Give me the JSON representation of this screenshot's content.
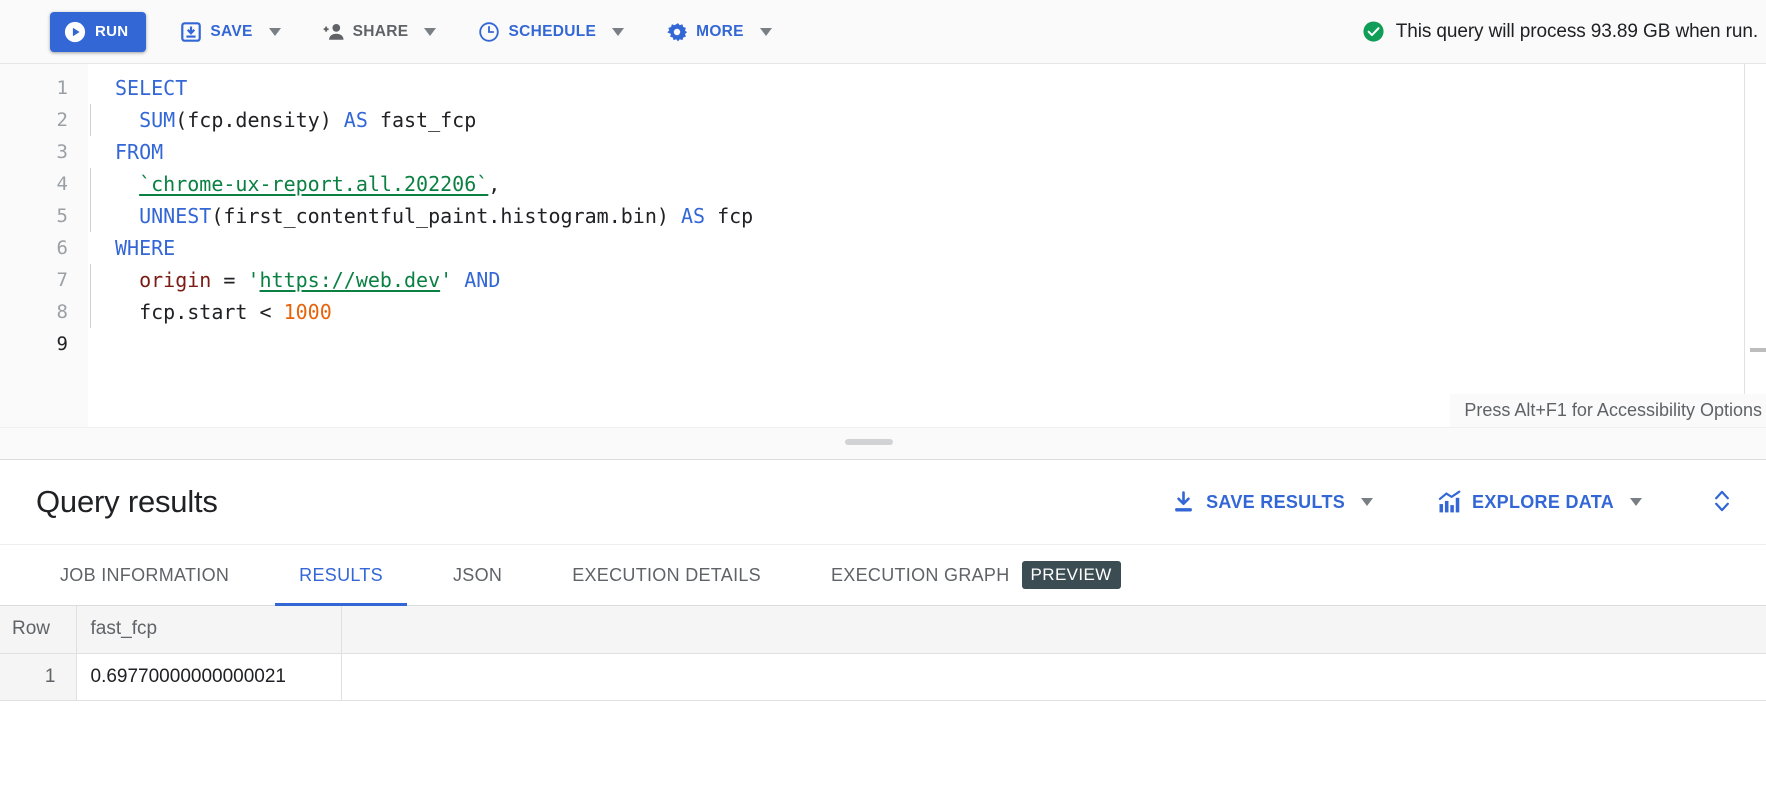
{
  "toolbar": {
    "run_label": "RUN",
    "save_label": "SAVE",
    "share_label": "SHARE",
    "schedule_label": "SCHEDULE",
    "more_label": "MORE",
    "status_text": "This query will process 93.89 GB when run.",
    "accent_color": "#3367d6",
    "status_color": "#0b8043"
  },
  "editor": {
    "line_numbers": [
      "1",
      "2",
      "3",
      "4",
      "5",
      "6",
      "7",
      "8",
      "9"
    ],
    "accessibility_hint": "Press Alt+F1 for Accessibility Options",
    "code_lines": [
      {
        "n": 1,
        "tokens": [
          {
            "t": "SELECT",
            "c": "kw"
          }
        ]
      },
      {
        "n": 2,
        "indent": true,
        "tokens": [
          {
            "t": "  ",
            "c": "pl"
          },
          {
            "t": "SUM",
            "c": "fn"
          },
          {
            "t": "(fcp.density) ",
            "c": "pl"
          },
          {
            "t": "AS",
            "c": "kw"
          },
          {
            "t": " fast_fcp",
            "c": "pl"
          }
        ]
      },
      {
        "n": 3,
        "tokens": [
          {
            "t": "FROM",
            "c": "kw"
          }
        ]
      },
      {
        "n": 4,
        "indent": true,
        "tokens": [
          {
            "t": "  ",
            "c": "pl"
          },
          {
            "t": "`chrome-ux-report.all.202206`",
            "c": "str"
          },
          {
            "t": ",",
            "c": "pl"
          }
        ]
      },
      {
        "n": 5,
        "indent": true,
        "tokens": [
          {
            "t": "  ",
            "c": "pl"
          },
          {
            "t": "UNNEST",
            "c": "fn"
          },
          {
            "t": "(first_contentful_paint.histogram.bin) ",
            "c": "pl"
          },
          {
            "t": "AS",
            "c": "kw"
          },
          {
            "t": " fcp",
            "c": "pl"
          }
        ]
      },
      {
        "n": 6,
        "tokens": [
          {
            "t": "WHERE",
            "c": "kw"
          }
        ]
      },
      {
        "n": 7,
        "indent": true,
        "tokens": [
          {
            "t": "  ",
            "c": "pl"
          },
          {
            "t": "origin",
            "c": "fld"
          },
          {
            "t": " = ",
            "c": "pl"
          },
          {
            "t": "'",
            "c": "strq"
          },
          {
            "t": "https://web.dev",
            "c": "str"
          },
          {
            "t": "'",
            "c": "strq"
          },
          {
            "t": " ",
            "c": "pl"
          },
          {
            "t": "AND",
            "c": "kw"
          }
        ]
      },
      {
        "n": 8,
        "indent": true,
        "tokens": [
          {
            "t": "  fcp.start < ",
            "c": "pl"
          },
          {
            "t": "1000",
            "c": "num"
          }
        ]
      },
      {
        "n": 9,
        "tokens": []
      }
    ],
    "plain_text": "SELECT\n  SUM(fcp.density) AS fast_fcp\nFROM\n  `chrome-ux-report.all.202206`,\n  UNNEST(first_contentful_paint.histogram.bin) AS fcp\nWHERE\n  origin = 'https://web.dev' AND\n  fcp.start < 1000\n"
  },
  "results": {
    "title": "Query results",
    "save_results_label": "SAVE RESULTS",
    "explore_data_label": "EXPLORE DATA",
    "tabs": [
      {
        "label": "JOB INFORMATION",
        "active": false,
        "badge": ""
      },
      {
        "label": "RESULTS",
        "active": true,
        "badge": ""
      },
      {
        "label": "JSON",
        "active": false,
        "badge": ""
      },
      {
        "label": "EXECUTION DETAILS",
        "active": false,
        "badge": ""
      },
      {
        "label": "EXECUTION GRAPH",
        "active": false,
        "badge": "PREVIEW"
      }
    ],
    "table": {
      "columns": [
        "Row",
        "fast_fcp"
      ],
      "rows": [
        {
          "row": "1",
          "fast_fcp": "0.69770000000000021"
        }
      ]
    }
  }
}
